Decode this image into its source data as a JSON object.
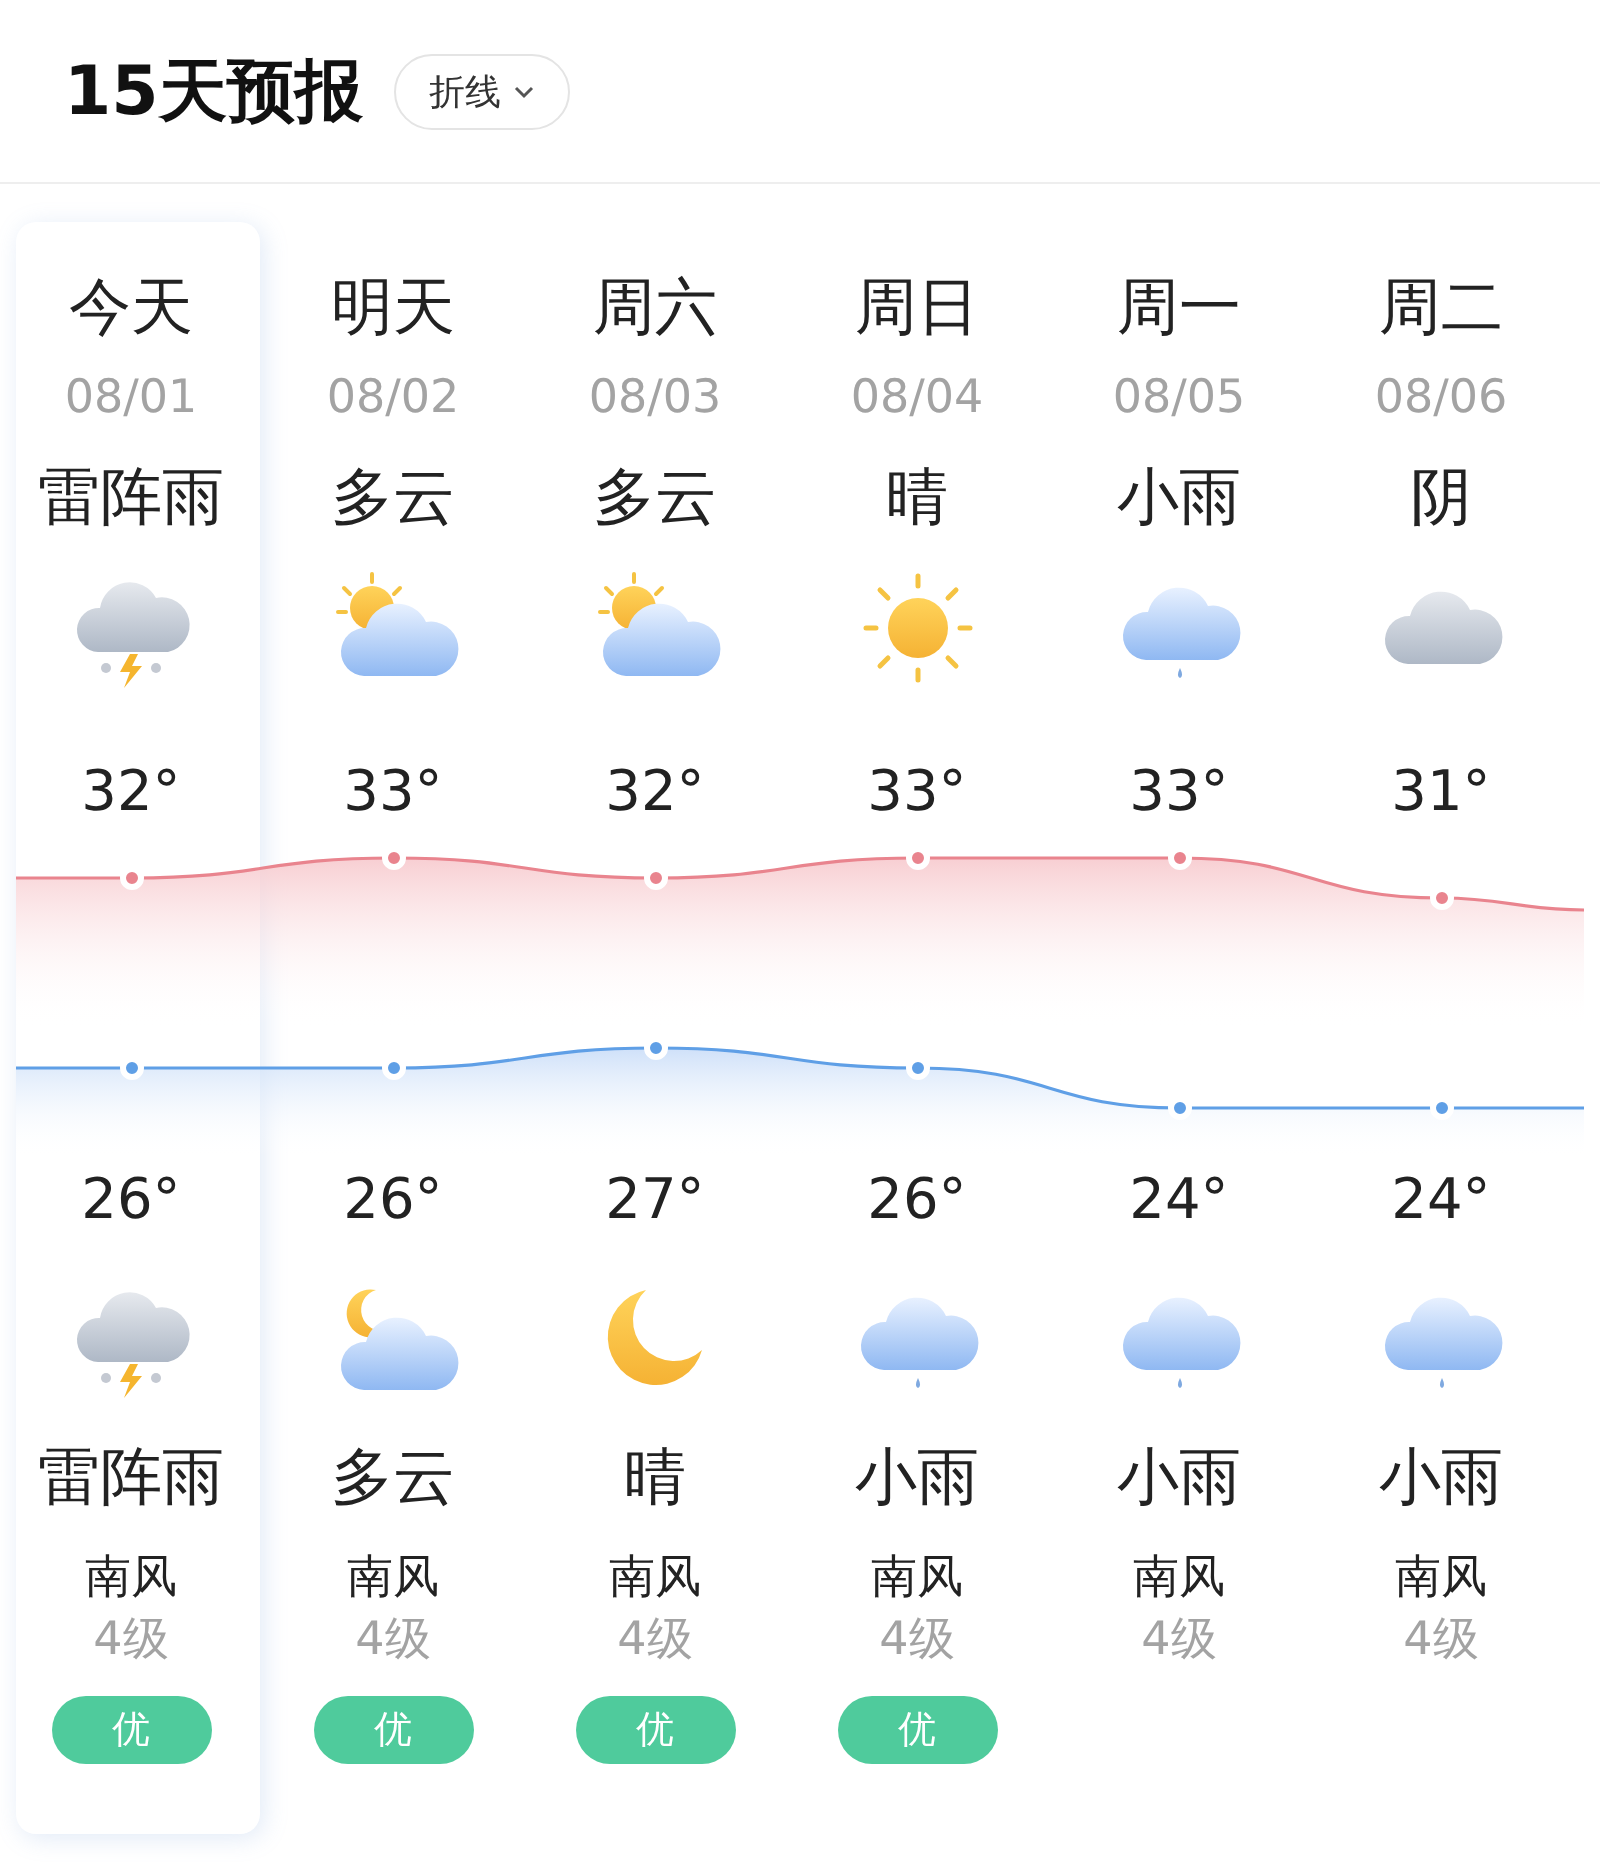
{
  "header": {
    "title": "15天预报",
    "mode_button": "折线"
  },
  "days": [
    {
      "name": "今天",
      "date": "08/01",
      "day_weather": "雷阵雨",
      "day_icon": {
        "kind": "thunderstorm"
      },
      "high": "32°",
      "low": "26°",
      "night_icon": {
        "kind": "thunderstorm"
      },
      "night_weather": "雷阵雨",
      "wind": "南风",
      "wind_level": "4级",
      "aqi": "优",
      "selected": true
    },
    {
      "name": "明天",
      "date": "08/02",
      "day_weather": "多云",
      "day_icon": {
        "kind": "suncloud"
      },
      "high": "33°",
      "low": "26°",
      "night_icon": {
        "kind": "mooncloud"
      },
      "night_weather": "多云",
      "wind": "南风",
      "wind_level": "4级",
      "aqi": "优",
      "selected": false
    },
    {
      "name": "周六",
      "date": "08/03",
      "day_weather": "多云",
      "day_icon": {
        "kind": "suncloud"
      },
      "high": "32°",
      "low": "27°",
      "night_icon": {
        "kind": "moon"
      },
      "night_weather": "晴",
      "wind": "南风",
      "wind_level": "4级",
      "aqi": "优",
      "selected": false
    },
    {
      "name": "周日",
      "date": "08/04",
      "day_weather": "晴",
      "day_icon": {
        "kind": "sun"
      },
      "high": "33°",
      "low": "26°",
      "night_icon": {
        "kind": "rain"
      },
      "night_weather": "小雨",
      "wind": "南风",
      "wind_level": "4级",
      "aqi": "优",
      "selected": false
    },
    {
      "name": "周一",
      "date": "08/05",
      "day_weather": "小雨",
      "day_icon": {
        "kind": "rain"
      },
      "high": "33°",
      "low": "24°",
      "night_icon": {
        "kind": "rain"
      },
      "night_weather": "小雨",
      "wind": "南风",
      "wind_level": "4级",
      "selected": false
    },
    {
      "name": "周二",
      "date": "08/06",
      "day_weather": "阴",
      "day_icon": {
        "kind": "cloud"
      },
      "high": "31°",
      "low": "24°",
      "night_icon": {
        "kind": "rain"
      },
      "night_weather": "小雨",
      "wind": "南风",
      "wind_level": "4级",
      "selected": false
    }
  ]
}
